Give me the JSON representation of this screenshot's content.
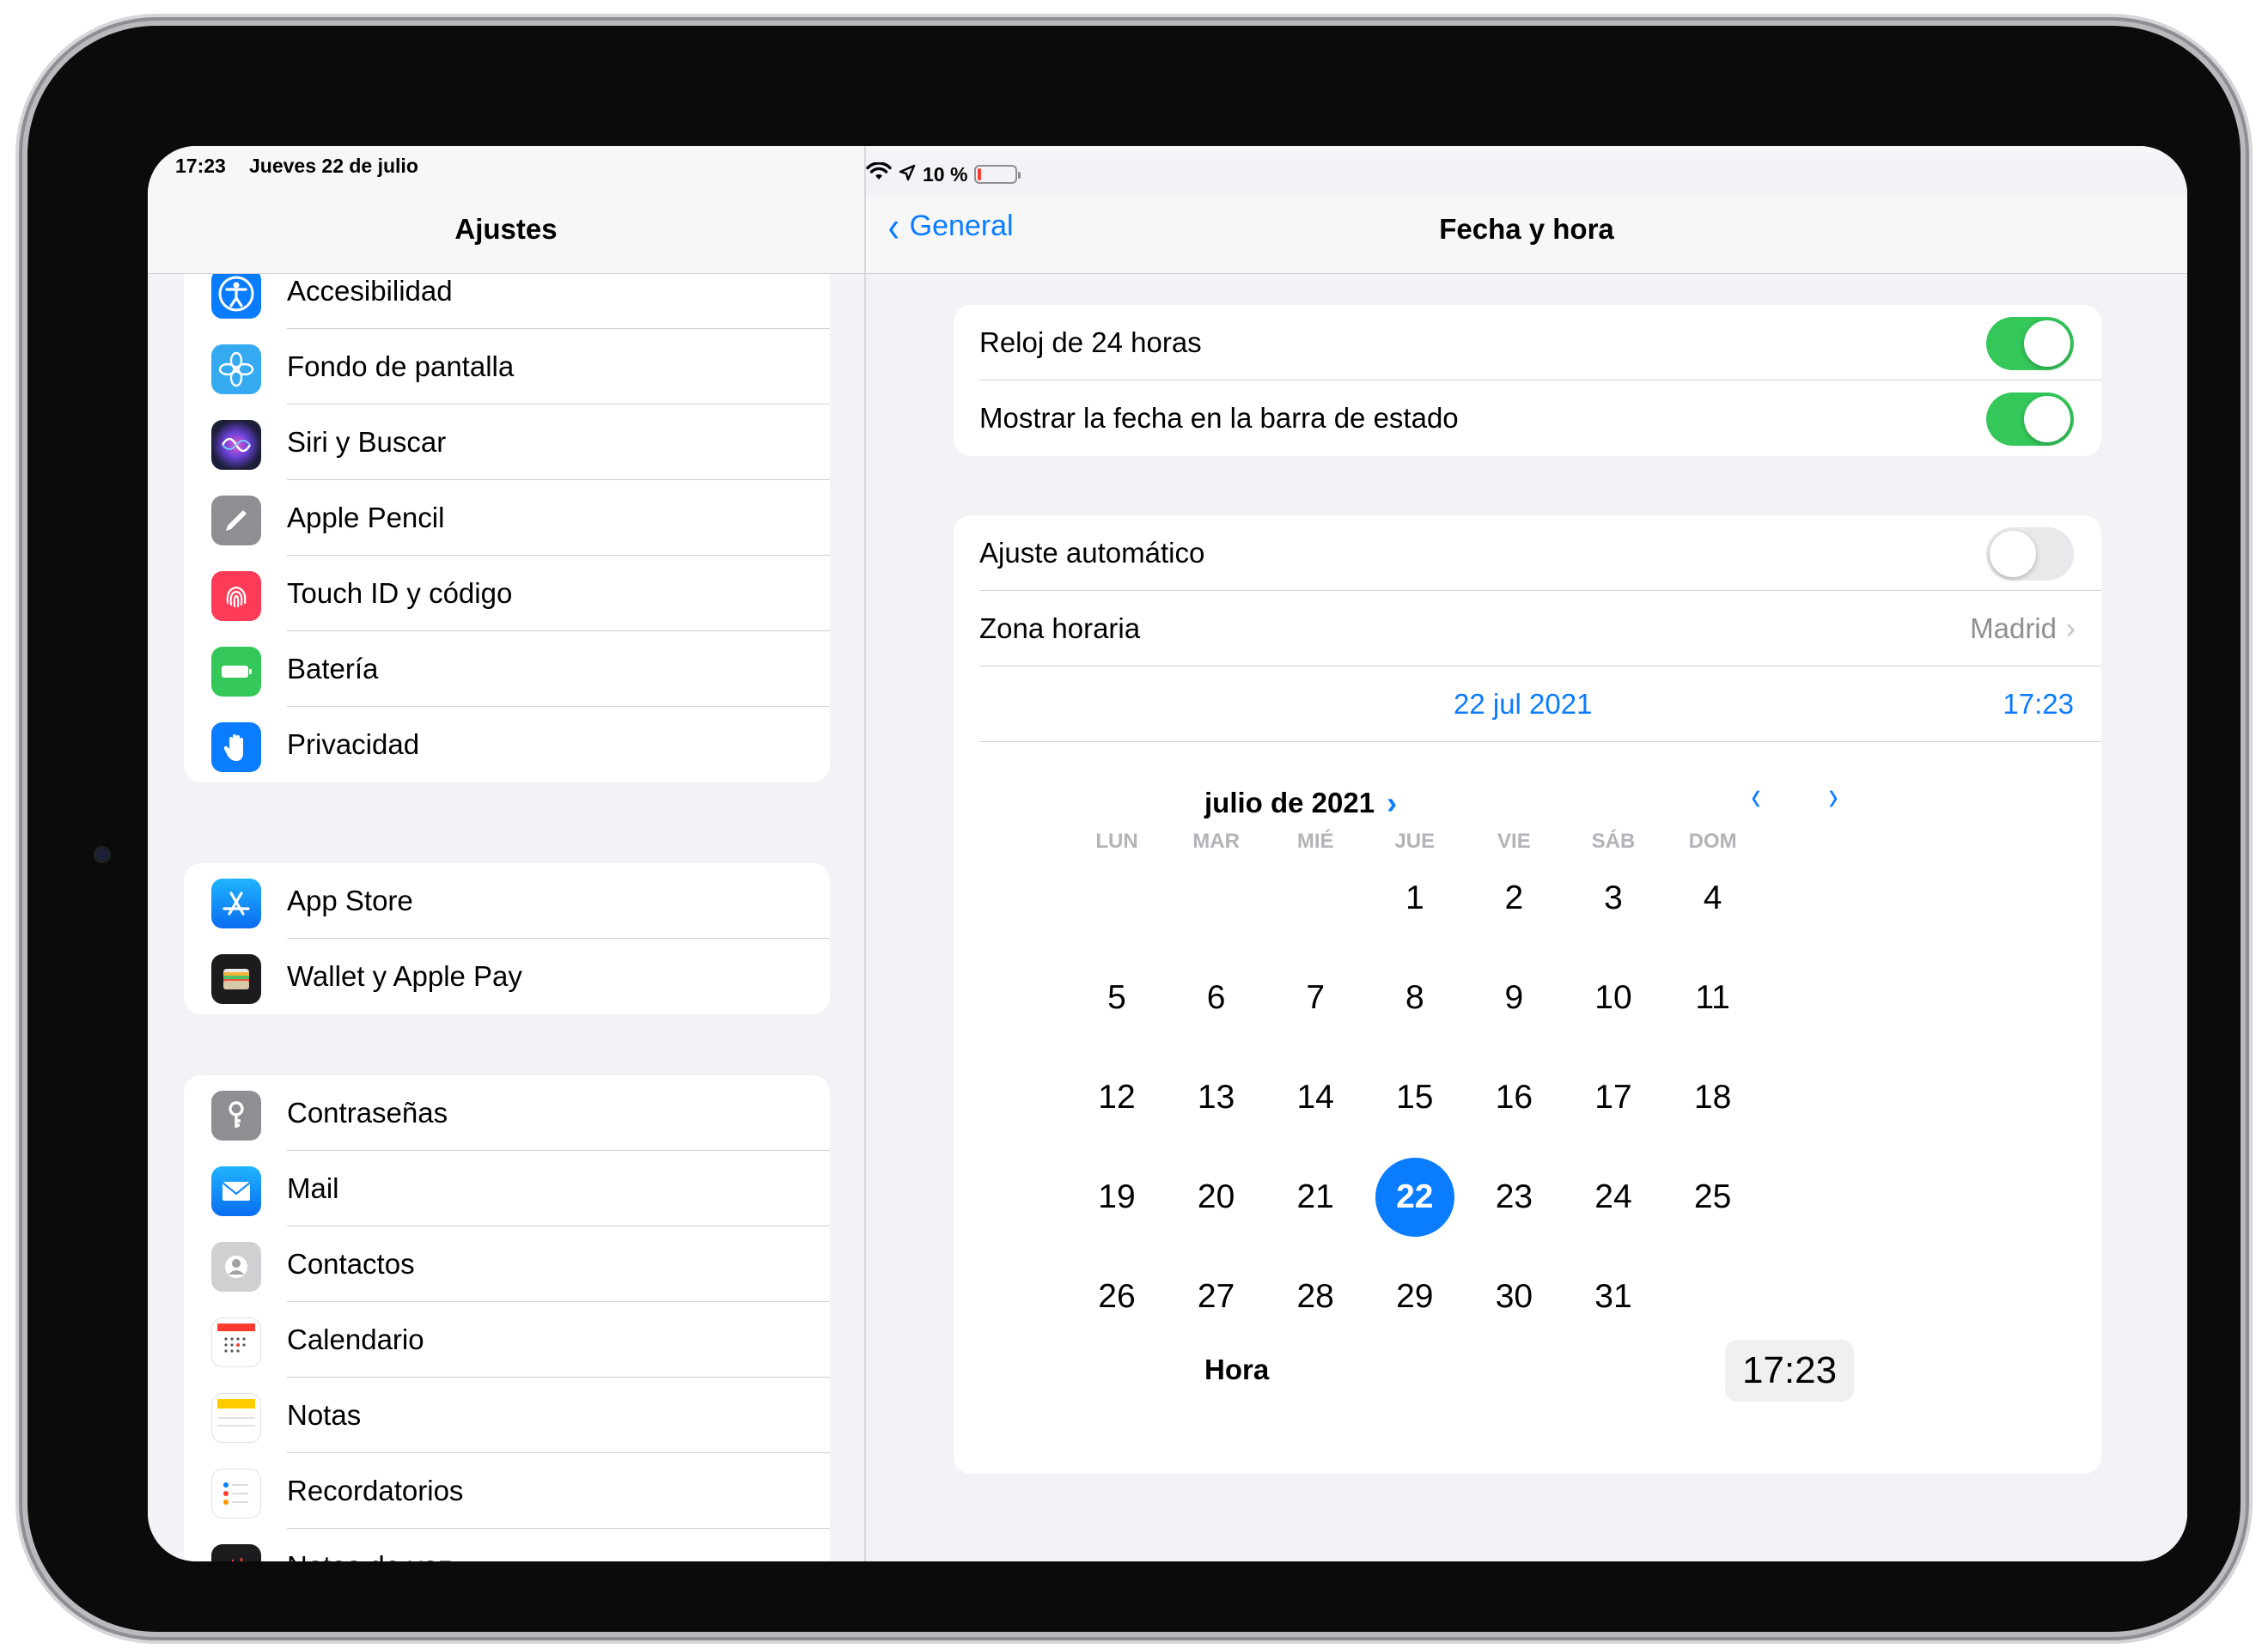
{
  "status_bar": {
    "time": "17:23",
    "date": "Jueves 22 de julio",
    "battery": "10 %",
    "battery_level": 0.1
  },
  "left": {
    "title": "Ajustes",
    "groups": [
      [
        {
          "label": "Accesibilidad",
          "icon": "accessibility-icon",
          "color": "#0a7cff"
        },
        {
          "label": "Fondo de pantalla",
          "icon": "wallpaper-flower-icon",
          "color": "#35aaf0"
        },
        {
          "label": "Siri y Buscar",
          "icon": "siri-icon",
          "color": "#1c1c3c"
        },
        {
          "label": "Apple Pencil",
          "icon": "pencil-icon",
          "color": "#8e8e93"
        },
        {
          "label": "Touch ID y código",
          "icon": "fingerprint-icon",
          "color": "#ff3b57"
        },
        {
          "label": "Batería",
          "icon": "battery-icon",
          "color": "#34c759"
        },
        {
          "label": "Privacidad",
          "icon": "hand-icon",
          "color": "#0a7cff"
        }
      ],
      [
        {
          "label": "App Store",
          "icon": "app-store-icon",
          "color": "#1a8cff"
        },
        {
          "label": "Wallet y Apple Pay",
          "icon": "wallet-icon",
          "color": "#1c1c1e"
        }
      ],
      [
        {
          "label": "Contraseñas",
          "icon": "key-icon",
          "color": "#8e8e93"
        },
        {
          "label": "Mail",
          "icon": "mail-icon",
          "color": "#1a8cff"
        },
        {
          "label": "Contactos",
          "icon": "contacts-icon",
          "color": "#d0d0d3"
        },
        {
          "label": "Calendario",
          "icon": "calendar-icon",
          "color": "#ffffff"
        },
        {
          "label": "Notas",
          "icon": "notes-icon",
          "color": "#ffffff"
        },
        {
          "label": "Recordatorios",
          "icon": "reminders-icon",
          "color": "#ffffff"
        },
        {
          "label": "Notas de voz",
          "icon": "voice-memos-icon",
          "color": "#1c1c1e"
        }
      ]
    ]
  },
  "right": {
    "back_label": "General",
    "title": "Fecha y hora",
    "clock24": {
      "label": "Reloj de 24 horas",
      "on": true
    },
    "show_date": {
      "label": "Mostrar la fecha en la barra de estado",
      "on": true
    },
    "auto": {
      "label": "Ajuste automático",
      "on": false
    },
    "timezone": {
      "label": "Zona horaria",
      "value": "Madrid"
    },
    "selected_date": "22 jul 2021",
    "selected_time": "17:23",
    "calendar": {
      "month_label": "julio de 2021",
      "weekdays": [
        "LUN",
        "MAR",
        "MIÉ",
        "JUE",
        "VIE",
        "SÁB",
        "DOM"
      ],
      "first_weekday_index": 3,
      "days_in_month": 31,
      "selected_day": 22
    },
    "hora_label": "Hora",
    "hora_value": "17:23"
  },
  "colors": {
    "accent": "#0a7cff",
    "toggle_on": "#34c759",
    "toggle_off": "#e9e9eb"
  }
}
